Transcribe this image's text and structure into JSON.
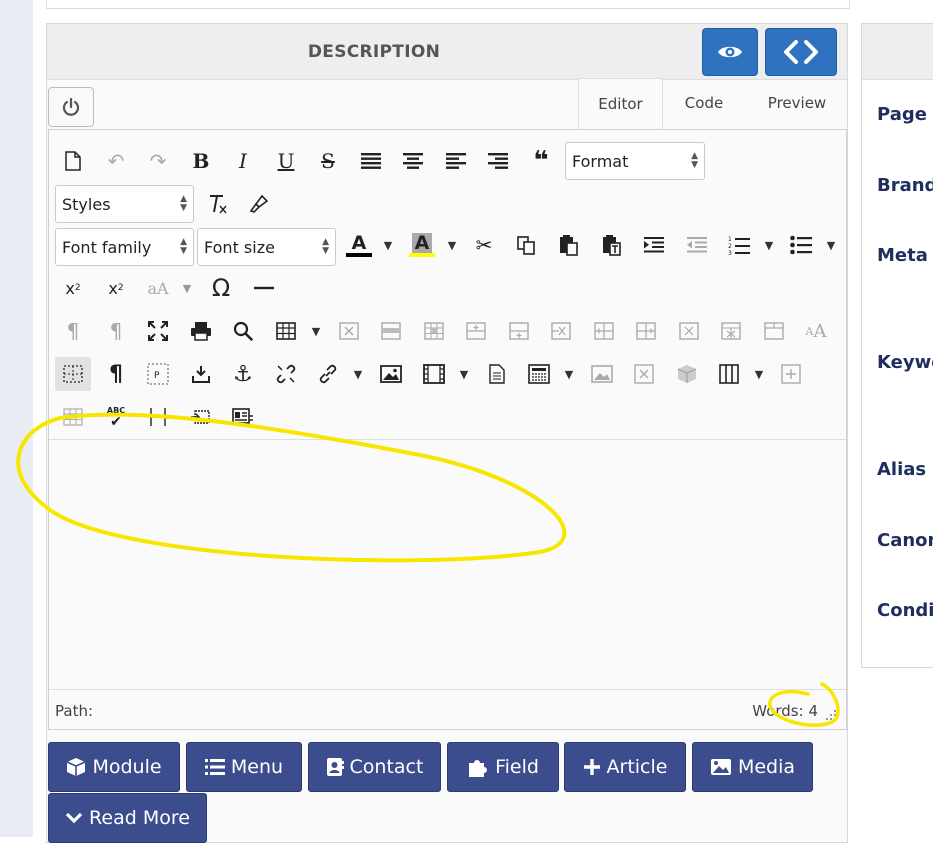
{
  "header": {
    "title": "DESCRIPTION"
  },
  "tabs": [
    {
      "label": "Editor"
    },
    {
      "label": "Code"
    },
    {
      "label": "Preview"
    }
  ],
  "toolbar": {
    "format_label": "Format",
    "styles_label": "Styles",
    "font_family_label": "Font family",
    "font_size_label": "Font size",
    "bold": "B",
    "italic": "I",
    "underline": "U",
    "strike": "S",
    "quote": "❝",
    "omega": "Ω",
    "spec_text": "ABC",
    "anchor": "⚓",
    "font_color": "A",
    "bg_color": "A",
    "p_label": "P",
    "aa_label": "aA",
    "colors": {
      "font_color": "#000000",
      "bg_highlight": "#ffff00"
    }
  },
  "status": {
    "path_label": "Path:",
    "words_label": "Words: 4"
  },
  "buttons": [
    {
      "label": "Module",
      "icon": "cube-icon"
    },
    {
      "label": "Menu",
      "icon": "list-icon"
    },
    {
      "label": "Contact",
      "icon": "address-card-icon"
    },
    {
      "label": "Field",
      "icon": "puzzle-icon"
    },
    {
      "label": "Article",
      "icon": "plus-icon"
    },
    {
      "label": "Media",
      "icon": "image-icon"
    },
    {
      "label": "Read More",
      "icon": "chevron-down-icon"
    }
  ],
  "right_panel": {
    "labels": [
      "Page t",
      "Brand",
      "Meta d",
      "Keywo",
      "Alias",
      "Canon",
      "Condit"
    ]
  },
  "colors": {
    "accent_blue": "#2f72c0",
    "button_navy": "#3c4d8e",
    "label_navy": "#1e2e5e",
    "annotation_yellow": "#f7e600"
  }
}
